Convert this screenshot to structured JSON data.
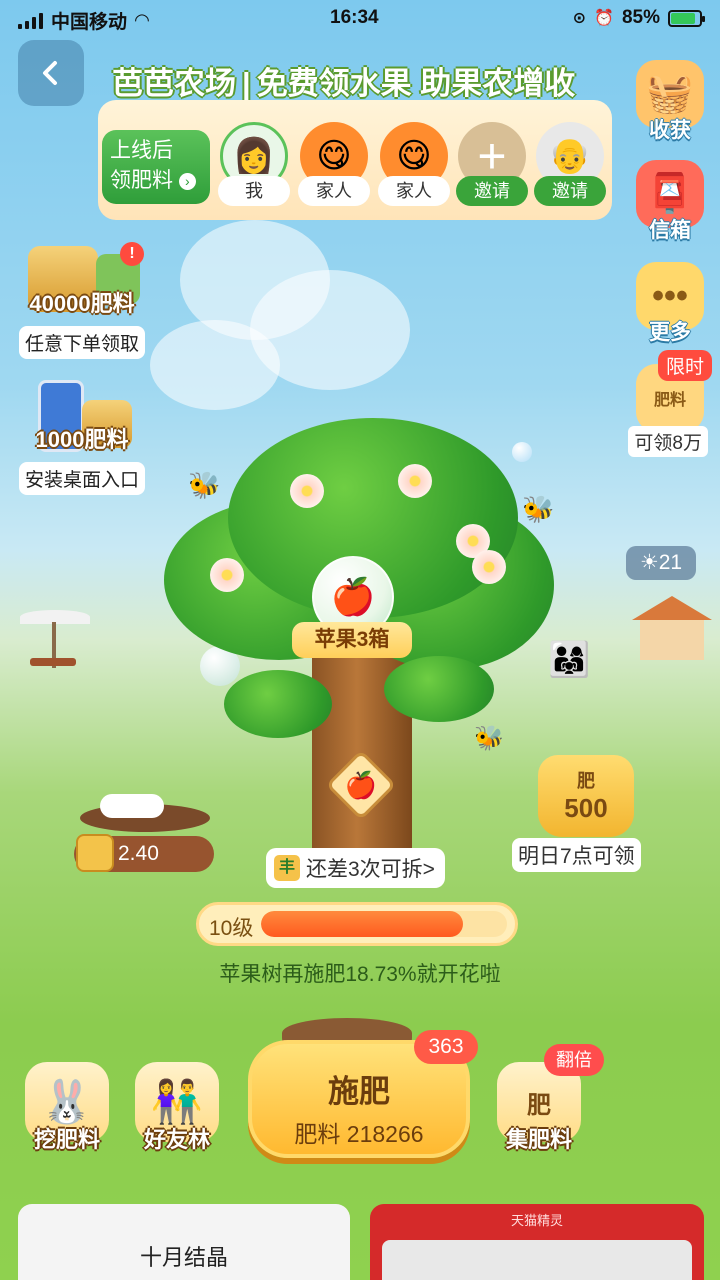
{
  "status_bar": {
    "carrier": "中国移动",
    "time": "16:34",
    "battery": "85%"
  },
  "header": {
    "title_left": "芭芭农场",
    "title_sep": "|",
    "title_right": "免费领水果 助果农增收"
  },
  "family_panel": {
    "online_card": {
      "line1": "上线后",
      "line2": "领肥料"
    },
    "members": [
      {
        "label": "我"
      },
      {
        "label": "家人"
      },
      {
        "label": "家人"
      },
      {
        "label": "邀请"
      },
      {
        "label": "邀请"
      }
    ]
  },
  "right_column": {
    "harvest": "收获",
    "mailbox": "信箱",
    "more": "更多",
    "limited_badge": "限时",
    "bag_word": "肥料",
    "free_label": "可领8万"
  },
  "left_column": {
    "order_card": {
      "amount": "40000肥料",
      "caption": "任意下单领取",
      "badge": "!"
    },
    "desktop_card": {
      "amount": "1000肥料",
      "caption": "安装桌面入口"
    }
  },
  "scene": {
    "fruit_label": "苹果3箱",
    "weather_temp": "21",
    "remain_chest_icon": "丰",
    "remain_chest": "还差3次可拆>",
    "pit_value": "2.40",
    "bag": {
      "word": "肥",
      "value": "500",
      "caption": "明日7点可领"
    }
  },
  "progress": {
    "level": "10级",
    "fraction": 0.82,
    "text": "苹果树再施肥18.73%就开花啦"
  },
  "bottom_bar": {
    "dig": "挖肥料",
    "friends": "好友林",
    "fertilize_title": "施肥",
    "fertilize_sub": "肥料 218266",
    "fertilize_badge": "363",
    "collect": "集肥料",
    "collect_word": "肥",
    "double_badge": "翻倍"
  },
  "cards": {
    "left_title": "十月结晶",
    "right_title": "天猫精灵"
  },
  "colors": {
    "accent_green": "#3aa43a",
    "accent_orange": "#ff5a1f",
    "badge_red": "#ff4b3e"
  }
}
